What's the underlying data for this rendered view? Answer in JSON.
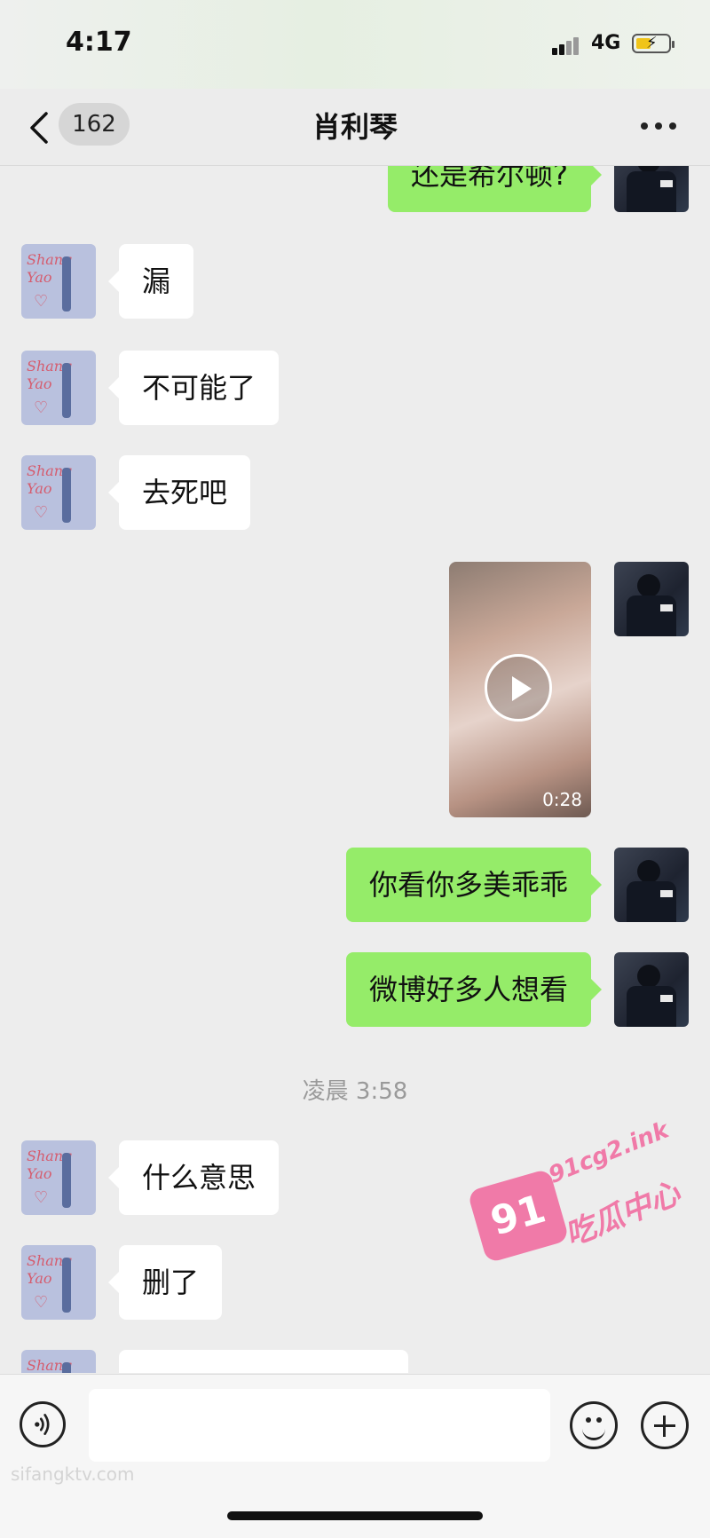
{
  "status_bar": {
    "time": "4:17",
    "network": "4G"
  },
  "nav": {
    "unread_count": "162",
    "title": "肖利琴"
  },
  "messages": [
    {
      "side": "right",
      "type": "text",
      "text": "还是希尔顿?"
    },
    {
      "side": "left",
      "type": "text",
      "text": "漏"
    },
    {
      "side": "left",
      "type": "text",
      "text": "不可能了"
    },
    {
      "side": "left",
      "type": "text",
      "text": "去死吧"
    },
    {
      "side": "right",
      "type": "video",
      "duration": "0:28"
    },
    {
      "side": "right",
      "type": "text",
      "text": "你看你多美乖乖"
    },
    {
      "side": "right",
      "type": "text",
      "text": "微博好多人想看"
    },
    {
      "side": "left",
      "type": "text",
      "text": "什么意思"
    },
    {
      "side": "left",
      "type": "text",
      "text": "删了"
    }
  ],
  "timestamp": "凌晨 3:58",
  "contact_avatar": {
    "text_line1": "Shang",
    "text_line2": "Yao"
  },
  "watermarks": {
    "logo_number": "91",
    "domain": "91cg2.ink",
    "site_name": "吃瓜中心",
    "corner": "sifangktv.com"
  },
  "icons": [
    "back-icon",
    "more-icon",
    "voice-icon",
    "emoji-icon",
    "plus-icon",
    "play-icon"
  ],
  "colors": {
    "sent_bubble": "#95ec69",
    "received_bubble": "#ffffff",
    "chat_background": "#ededed",
    "watermark": "#f07aa8"
  }
}
